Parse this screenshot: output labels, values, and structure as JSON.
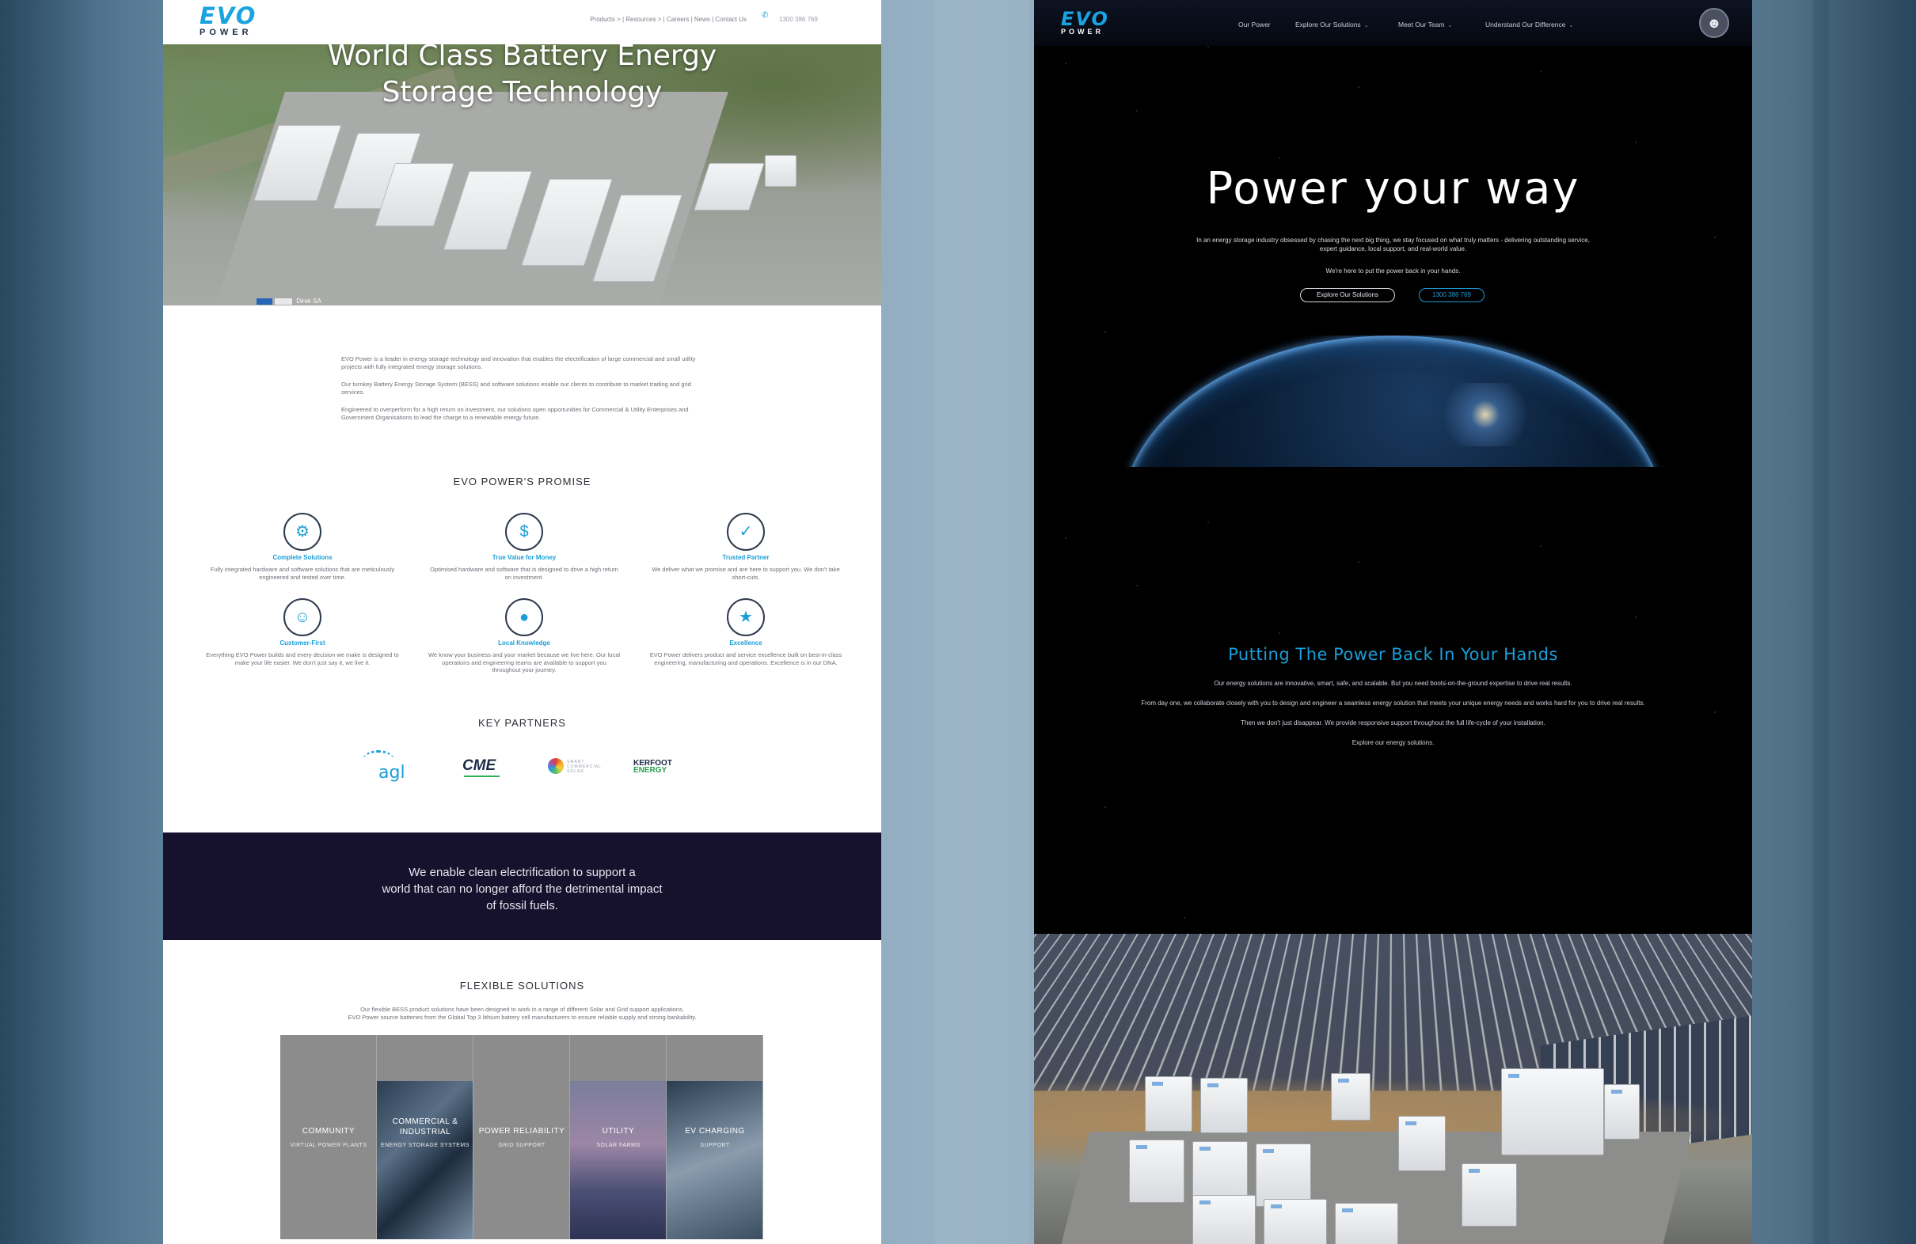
{
  "left_page": {
    "logo": {
      "evo": "EVO",
      "power": "POWER"
    },
    "nav": "Products  >  | Resources  >  | Careers | News | Contact Us",
    "phone_icon": "phone-icon",
    "phone": "1300 386 769",
    "hero": {
      "title_line1": "World Class Battery Energy",
      "title_line2": "Storage Technology",
      "caption": "Direk SA"
    },
    "intro": [
      "EVO Power is a leader in energy storage technology and innovation that enables the electrification of large commercial and small utility projects with fully integrated energy storage solutions.",
      "Our turnkey Battery Energy Storage System (BESS) and software solutions enable our clients to contribute to market trading and grid services.",
      "Engineered to overperform for a high return on investment, our solutions open opportunities for Commercial & Utility Enterprises and Government Organisations to lead the charge to a renewable energy future."
    ],
    "promise_title": "EVO POWER'S PROMISE",
    "promises": [
      {
        "icon": "team-gear-icon",
        "title": "Complete Solutions",
        "desc": "Fully integrated hardware and software solutions that are meticulously engineered and tested over time."
      },
      {
        "icon": "gear-dollar-icon",
        "title": "True Value for Money",
        "desc": "Optimised hardware and software that is designed to drive a high return on investment."
      },
      {
        "icon": "handshake-shield-icon",
        "title": "Trusted Partner",
        "desc": "We deliver what we promise and are here to support you. We don't take short-cuts."
      },
      {
        "icon": "people-hand-icon",
        "title": "Customer-First",
        "desc": "Everything EVO Power builds and every decision we make is designed to make your life easier. We don't just say it, we live it."
      },
      {
        "icon": "location-pin-icon",
        "title": "Local Knowledge",
        "desc": "We know your business and your market because we live here. Our local operations and engineering teams are available to support you throughout your journey."
      },
      {
        "icon": "award-badge-icon",
        "title": "Excellence",
        "desc": "EVO Power delivers product and service excellence built on best-in-class engineering, manufacturing and operations. Excellence is in our DNA."
      }
    ],
    "partners_title": "KEY PARTNERS",
    "partners": {
      "agl": "agl",
      "cme": "CME",
      "scs": "SMART COMMERCIAL SOLAR",
      "kerfoot": "KERFOOT",
      "kerfoot_sub": "ENERGY"
    },
    "band_text": [
      "We enable clean electrification to support a",
      "world that can no longer afford the detrimental impact",
      "of fossil fuels."
    ],
    "flex_title": "FLEXIBLE SOLUTIONS",
    "flex_sub": [
      "Our flexible BESS product solutions have been designed to work in a range of different Solar and Grid support applications.",
      "EVO Power source batteries from the Global Top 3 lithium battery cell manufacturers to ensure reliable supply and strong bankability."
    ],
    "tiles": [
      {
        "title": "COMMUNITY",
        "sub": "VIRTUAL POWER PLANTS"
      },
      {
        "title": "COMMERCIAL & INDUSTRIAL",
        "sub": "ENERGY STORAGE SYSTEMS"
      },
      {
        "title": "POWER RELIABILITY",
        "sub": "GRID SUPPORT"
      },
      {
        "title": "UTILITY",
        "sub": "SOLAR FARMS"
      },
      {
        "title": "EV CHARGING",
        "sub": "SUPPORT"
      }
    ]
  },
  "right_page": {
    "logo": {
      "evo": "EVO",
      "power": "POWER"
    },
    "nav": [
      {
        "label": "Our Power"
      },
      {
        "label": "Explore Our Solutions",
        "chevron": "⌄"
      },
      {
        "label": "Meet Our Team",
        "chevron": "⌄"
      },
      {
        "label": "Understand Our Difference",
        "chevron": "⌄"
      }
    ],
    "avatar_icon": "astronaut-icon",
    "hero": {
      "title": "Power your way",
      "sub": "In an energy storage industry obsessed by chasing the next big thing, we stay focused on what truly matters - delivering outstanding service, expert guidance, local support, and real-world value.",
      "sub2": "We're here to put the power back in your hands.",
      "btn_primary": "Explore Our Solutions",
      "btn_phone": "1300 386 769"
    },
    "section": {
      "title": "Putting The Power Back In Your Hands",
      "paragraphs": [
        "Our energy solutions are innovative, smart, safe, and scalable. But you need boots-on-the-ground expertise to drive real results.",
        "From day one, we collaborate closely with you to design and engineer a seamless energy solution that meets your unique energy needs and works hard for you to drive real results.",
        "Then we don't just disappear. We provide responsive support throughout the full life-cycle of your installation.",
        "Explore our energy solutions."
      ]
    }
  },
  "colors": {
    "accent": "#1a9ed8",
    "band": "#16122d",
    "navy": "#1d2b4a"
  }
}
